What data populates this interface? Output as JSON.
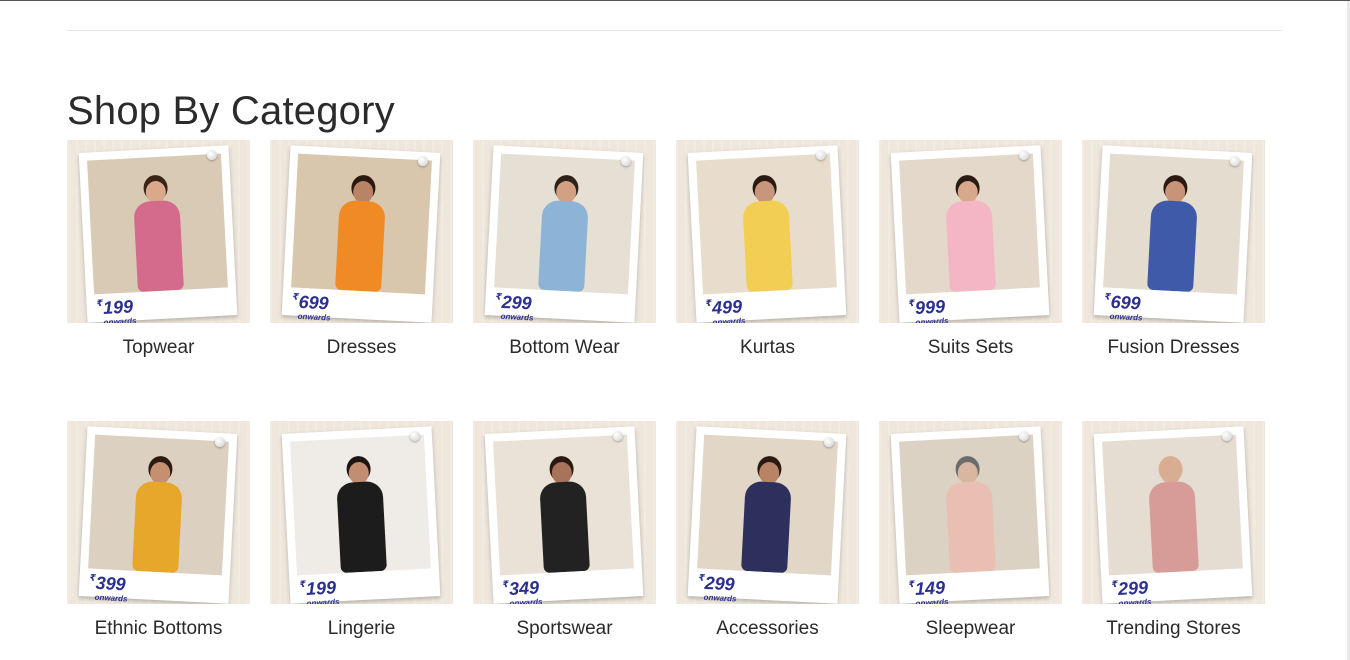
{
  "section": {
    "title": "Shop By Category"
  },
  "categories": [
    {
      "label": "Topwear",
      "price_symbol": "₹",
      "price": "199",
      "price_suffix": "onwards",
      "skin": "#d9a98a",
      "outfit": "#d46a8c",
      "hair": "#3a2418",
      "backdrop": "#d9cab6",
      "tilt": "l"
    },
    {
      "label": "Dresses",
      "price_symbol": "₹",
      "price": "699",
      "price_suffix": "onwards",
      "skin": "#b98366",
      "outfit": "#f08a24",
      "hair": "#2a1a12",
      "backdrop": "#d8c6ad",
      "tilt": "r"
    },
    {
      "label": "Bottom Wear",
      "price_symbol": "₹",
      "price": "299",
      "price_suffix": "onwards",
      "skin": "#d2a184",
      "outfit": "#8db4d6",
      "hair": "#2e211a",
      "backdrop": "#e6dfd3",
      "tilt": "r"
    },
    {
      "label": "Kurtas",
      "price_symbol": "₹",
      "price": "499",
      "price_suffix": "onwards",
      "skin": "#c8967a",
      "outfit": "#f2cf52",
      "hair": "#2a1a12",
      "backdrop": "#e8ddcc",
      "tilt": "l"
    },
    {
      "label": "Suits Sets",
      "price_symbol": "₹",
      "price": "999",
      "price_suffix": "onwards",
      "skin": "#d7a889",
      "outfit": "#f4b6c4",
      "hair": "#2a1a12",
      "backdrop": "#e3d8ca",
      "tilt": "l"
    },
    {
      "label": "Fusion Dresses",
      "price_symbol": "₹",
      "price": "699",
      "price_suffix": "onwards",
      "skin": "#c99377",
      "outfit": "#3e5aa8",
      "hair": "#2a1a12",
      "backdrop": "#e4dccf",
      "tilt": "r"
    },
    {
      "label": "Ethnic Bottoms",
      "price_symbol": "₹",
      "price": "399",
      "price_suffix": "onwards",
      "skin": "#c58f72",
      "outfit": "#e7a72a",
      "hair": "#2a1a12",
      "backdrop": "#dcd0c0",
      "tilt": "r"
    },
    {
      "label": "Lingerie",
      "price_symbol": "₹",
      "price": "199",
      "price_suffix": "onwards",
      "skin": "#c28d70",
      "outfit": "#1c1c1c",
      "hair": "#1f1510",
      "backdrop": "#efebe6",
      "tilt": "l"
    },
    {
      "label": "Sportswear",
      "price_symbol": "₹",
      "price": "349",
      "price_suffix": "onwards",
      "skin": "#a8735a",
      "outfit": "#222222",
      "hair": "#2a1a12",
      "backdrop": "#eae2d7",
      "tilt": "l"
    },
    {
      "label": "Accessories",
      "price_symbol": "₹",
      "price": "299",
      "price_suffix": "onwards",
      "skin": "#b98366",
      "outfit": "#2d2f5c",
      "hair": "#2a1a12",
      "backdrop": "#e2d6c6",
      "tilt": "r"
    },
    {
      "label": "Sleepwear",
      "price_symbol": "₹",
      "price": "149",
      "price_suffix": "onwards",
      "skin": "#d8b7a0",
      "outfit": "#e9bfb3",
      "hair": "#6b6b6b",
      "backdrop": "#dcd2c4",
      "tilt": "l"
    },
    {
      "label": "Trending Stores",
      "price_symbol": "₹",
      "price": "299",
      "price_suffix": "onwards",
      "skin": "#d8ad92",
      "outfit": "#d79c98",
      "hair": "#d8ad92",
      "backdrop": "#e6ddd2",
      "tilt": "l"
    }
  ]
}
